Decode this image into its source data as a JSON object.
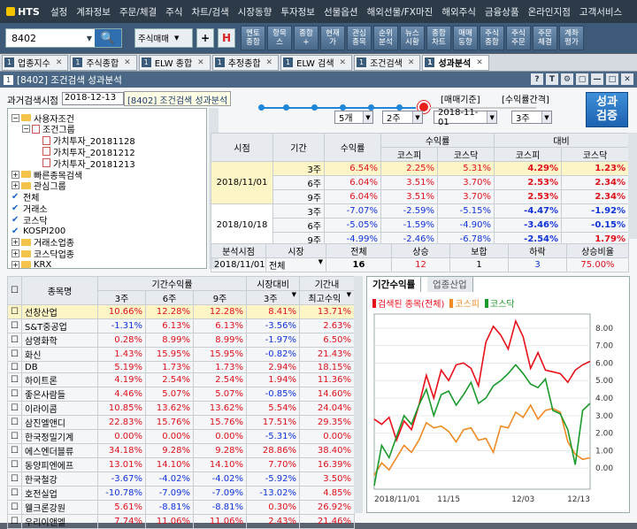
{
  "app": {
    "logo": "HTS"
  },
  "menu": [
    "설정",
    "계좌정보",
    "주문/체결",
    "주식",
    "차트/검색",
    "시장동향",
    "투자정보",
    "선물옵션",
    "해외선물/FX마진",
    "해외주식",
    "금융상품",
    "온라인지점",
    "고객서비스"
  ],
  "toolbar": {
    "code": "8402",
    "order_select": "주식매매",
    "buttons": [
      "멘토\n종합",
      "항목\n스",
      "종합\n+",
      "현재\n가",
      "관심\n종목",
      "순위\n분석",
      "뉴스\n시황",
      "종합\n차트",
      "매매\n동향",
      "주식\n종합",
      "주식\n주문",
      "주문\n체결",
      "계좌\n평가"
    ]
  },
  "window_tabs": [
    {
      "num": "1",
      "label": "업종지수"
    },
    {
      "num": "1",
      "label": "주식종합"
    },
    {
      "num": "1",
      "label": "ELW 종합"
    },
    {
      "num": "1",
      "label": "추정종합"
    },
    {
      "num": "1",
      "label": "ELW 검색"
    },
    {
      "num": "1",
      "label": "조건검색"
    },
    {
      "num": "1",
      "label": "성과분석"
    }
  ],
  "window": {
    "num": "1",
    "title": "[8402] 조건검색 성과분석",
    "ctrls": [
      "?",
      "T",
      "⚙",
      "▢",
      "—",
      "□",
      "✕"
    ]
  },
  "criteria": {
    "past_date_label": "과거검색시점",
    "past_date": "2018-12-13",
    "tooltip": "[8402] 조건검색 성과분석",
    "bracket_left": "[매매기준]",
    "bracket_right": "[수익률간격]",
    "sel_count": "5개",
    "sel_week": "2주",
    "sel_date": "2018-11-01",
    "sel_interval": "3주",
    "perf_button": "성과\n검증"
  },
  "tree": [
    {
      "level": 0,
      "toggle": "−",
      "icon": "folder",
      "label": "사용자조건"
    },
    {
      "level": 1,
      "toggle": "−",
      "icon": "doc",
      "label": "조건그룹"
    },
    {
      "level": 2,
      "toggle": "",
      "icon": "doc",
      "label": "가치투자_20181128"
    },
    {
      "level": 2,
      "toggle": "",
      "icon": "doc",
      "label": "가치투자_20181212"
    },
    {
      "level": 2,
      "toggle": "",
      "icon": "doc",
      "label": "가치투자_20181213"
    },
    {
      "level": 0,
      "toggle": "+",
      "icon": "folder",
      "label": "빠른종목검색"
    },
    {
      "level": 0,
      "toggle": "+",
      "icon": "folder",
      "label": "관심그룹"
    },
    {
      "level": 0,
      "toggle": "",
      "icon": "check",
      "label": "전체"
    },
    {
      "level": 0,
      "toggle": "",
      "icon": "check",
      "label": "거래소"
    },
    {
      "level": 0,
      "toggle": "",
      "icon": "check",
      "label": "코스닥"
    },
    {
      "level": 0,
      "toggle": "",
      "icon": "check",
      "label": "KOSPI200"
    },
    {
      "level": 0,
      "toggle": "+",
      "icon": "folder",
      "label": "거래소업종"
    },
    {
      "level": 0,
      "toggle": "+",
      "icon": "folder",
      "label": "코스닥업종"
    },
    {
      "level": 0,
      "toggle": "+",
      "icon": "folder",
      "label": "KRX"
    }
  ],
  "perf_table": {
    "headers": {
      "time": "시점",
      "period": "기간",
      "return": "수익률",
      "ret_group": "수익률",
      "cmp_group": "대비",
      "kospi": "코스피",
      "kosdaq": "코스닥"
    },
    "rows": [
      {
        "date": "2018/11/01",
        "period": "3주",
        "ret": "6.54%",
        "rk": "2.25%",
        "rq": "5.31%",
        "ck": "4.29%",
        "cq": "1.23%",
        "hl": true
      },
      {
        "date": "",
        "period": "6주",
        "ret": "6.04%",
        "rk": "3.51%",
        "rq": "3.70%",
        "ck": "2.53%",
        "cq": "2.34%",
        "hl": false
      },
      {
        "date": "",
        "period": "9주",
        "ret": "6.04%",
        "rk": "3.51%",
        "rq": "3.70%",
        "ck": "2.53%",
        "cq": "2.34%",
        "hl": false
      },
      {
        "date": "2018/10/18",
        "period": "3주",
        "ret": "-7.07%",
        "rk": "-2.59%",
        "rq": "-5.15%",
        "ck": "-4.47%",
        "cq": "-1.92%",
        "hl": false
      },
      {
        "date": "",
        "period": "6주",
        "ret": "-5.05%",
        "rk": "-1.59%",
        "rq": "-4.90%",
        "ck": "-3.46%",
        "cq": "-0.15%",
        "hl": false
      },
      {
        "date": "",
        "period": "9주",
        "ret": "-4.99%",
        "rk": "-2.46%",
        "rq": "-6.78%",
        "ck": "-2.54%",
        "cq": "1.79%",
        "hl": false
      }
    ]
  },
  "summary": {
    "headers": [
      "분석시점",
      "시장",
      "전체",
      "상승",
      "보합",
      "하락",
      "상승비율"
    ],
    "values": {
      "date": "2018/11/01",
      "market": "전체",
      "total": "16",
      "up": "12",
      "flat": "1",
      "down": "3",
      "ratio": "75.00%"
    }
  },
  "stock_table": {
    "headers": {
      "name": "종목명",
      "period_ret": "기간수익률",
      "market_cmp": "시장대비",
      "in_period": "기간내",
      "w3": "3주",
      "w6": "6주",
      "w9": "9주",
      "max": "최고수익"
    },
    "rows": [
      {
        "name": "선창산업",
        "a": "10.66%",
        "b": "12.28%",
        "c": "12.28%",
        "d": "8.41%",
        "e": "13.71%",
        "hl": true
      },
      {
        "name": "S&T중공업",
        "a": "-1.31%",
        "b": "6.13%",
        "c": "6.13%",
        "d": "-3.56%",
        "e": "2.63%",
        "hl": false
      },
      {
        "name": "삼영화학",
        "a": "0.28%",
        "b": "8.99%",
        "c": "8.99%",
        "d": "-1.97%",
        "e": "6.50%",
        "hl": false
      },
      {
        "name": "화신",
        "a": "1.43%",
        "b": "15.95%",
        "c": "15.95%",
        "d": "-0.82%",
        "e": "21.43%",
        "hl": false
      },
      {
        "name": "DB",
        "a": "5.19%",
        "b": "1.73%",
        "c": "1.73%",
        "d": "2.94%",
        "e": "18.15%",
        "hl": false
      },
      {
        "name": "하이트론",
        "a": "4.19%",
        "b": "2.54%",
        "c": "2.54%",
        "d": "1.94%",
        "e": "11.36%",
        "hl": false
      },
      {
        "name": "좋은사람들",
        "a": "4.46%",
        "b": "5.07%",
        "c": "5.07%",
        "d": "-0.85%",
        "e": "14.60%",
        "hl": false
      },
      {
        "name": "이라이콤",
        "a": "10.85%",
        "b": "13.62%",
        "c": "13.62%",
        "d": "5.54%",
        "e": "24.04%",
        "hl": false
      },
      {
        "name": "삼진엘앤디",
        "a": "22.83%",
        "b": "15.76%",
        "c": "15.76%",
        "d": "17.51%",
        "e": "29.35%",
        "hl": false
      },
      {
        "name": "한국정밀기계",
        "a": "0.00%",
        "b": "0.00%",
        "c": "0.00%",
        "d": "-5.31%",
        "e": "0.00%",
        "hl": false
      },
      {
        "name": "에스엔더블류",
        "a": "34.18%",
        "b": "9.28%",
        "c": "9.28%",
        "d": "28.86%",
        "e": "38.40%",
        "hl": false
      },
      {
        "name": "동양피엔에프",
        "a": "13.01%",
        "b": "14.10%",
        "c": "14.10%",
        "d": "7.70%",
        "e": "16.39%",
        "hl": false
      },
      {
        "name": "한국철강",
        "a": "-3.67%",
        "b": "-4.02%",
        "c": "-4.02%",
        "d": "-5.92%",
        "e": "3.50%",
        "hl": false
      },
      {
        "name": "호전실업",
        "a": "-10.78%",
        "b": "-7.09%",
        "c": "-7.09%",
        "d": "-13.02%",
        "e": "4.85%",
        "hl": false
      },
      {
        "name": "웰크론강원",
        "a": "5.61%",
        "b": "-8.81%",
        "c": "-8.81%",
        "d": "0.30%",
        "e": "26.92%",
        "hl": false
      },
      {
        "name": "우리이앤엘",
        "a": "7.74%",
        "b": "11.06%",
        "c": "11.06%",
        "d": "2.43%",
        "e": "21.46%",
        "hl": false
      }
    ]
  },
  "chart_tabs": [
    "기간수익률",
    "업종산업"
  ],
  "chart_data": {
    "type": "line",
    "legend": [
      "검색된 종목(전체)",
      "코스피",
      "코스닥"
    ],
    "colors": [
      "#e8101a",
      "#f08a24",
      "#1a9a2a"
    ],
    "x_ticks": [
      "2018/11/01",
      "11/15",
      "12/03",
      "12/13"
    ],
    "ylim": [
      -1.2,
      8.8
    ],
    "y_ticks": [
      "8.00",
      "7.00",
      "6.00",
      "5.00",
      "4.00",
      "3.00",
      "2.00",
      "1.00",
      "0.00"
    ],
    "series": [
      {
        "name": "검색된 종목(전체)",
        "values": [
          2.8,
          2.5,
          2.9,
          1.6,
          2.7,
          2.2,
          3.6,
          5.3,
          4.0,
          5.6,
          5.0,
          5.9,
          6.0,
          5.7,
          4.7,
          7.2,
          8.1,
          7.6,
          6.8,
          8.4,
          7.5,
          5.7,
          6.6,
          5.6,
          5.5,
          5.4,
          4.9,
          5.6,
          5.9,
          6.1
        ]
      },
      {
        "name": "코스피",
        "values": [
          -0.4,
          0.3,
          -0.1,
          0.6,
          1.3,
          0.9,
          1.6,
          2.6,
          2.3,
          2.4,
          2.1,
          1.5,
          2.2,
          2.3,
          1.6,
          1.7,
          0.9,
          2.4,
          2.3,
          3.2,
          2.9,
          3.6,
          2.8,
          3.3,
          3.4,
          3.2,
          1.5,
          0.8,
          0.5,
          0.6
        ]
      },
      {
        "name": "코스닥",
        "values": [
          -1.0,
          1.3,
          0.6,
          1.8,
          3.0,
          2.5,
          3.6,
          4.5,
          3.0,
          4.2,
          4.4,
          3.6,
          4.2,
          4.9,
          3.7,
          4.0,
          4.7,
          5.0,
          5.4,
          5.9,
          5.4,
          4.8,
          4.6,
          5.1,
          3.3,
          3.1,
          2.2,
          0.2,
          3.3,
          3.7
        ]
      }
    ]
  }
}
